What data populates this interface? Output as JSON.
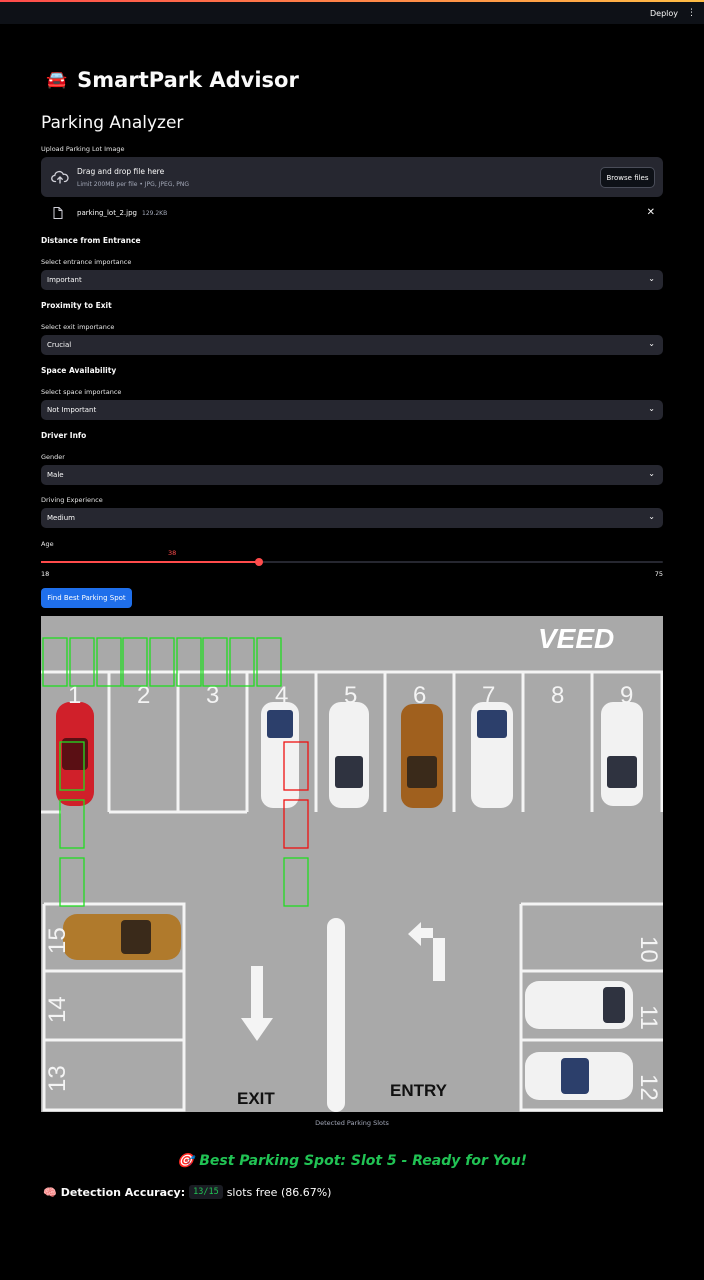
{
  "header": {
    "deploy_label": "Deploy",
    "menu_icon": "kebab-menu-icon"
  },
  "app": {
    "title_emoji": "🚘",
    "title": "SmartPark Advisor",
    "subtitle": "Parking Analyzer"
  },
  "uploader": {
    "label": "Upload Parking Lot Image",
    "drag_text": "Drag and drop file here",
    "limit_text": "Limit 200MB per file • JPG, JPEG, PNG",
    "browse_label": "Browse files",
    "file_name": "parking_lot_2.jpg",
    "file_size": "129.2KB"
  },
  "sections": {
    "entrance": {
      "heading": "Distance from Entrance",
      "label": "Select entrance importance",
      "value": "Important"
    },
    "exit": {
      "heading": "Proximity to Exit",
      "label": "Select exit importance",
      "value": "Crucial"
    },
    "space": {
      "heading": "Space Availability",
      "label": "Select space importance",
      "value": "Not Important"
    },
    "driver": {
      "heading": "Driver Info",
      "gender_label": "Gender",
      "gender_value": "Male",
      "experience_label": "Driving Experience",
      "experience_value": "Medium"
    }
  },
  "age": {
    "label": "Age",
    "value": 38,
    "min": 18,
    "max": 75
  },
  "find_button": "Find Best Parking Spot",
  "lot_image": {
    "watermark": "VEED",
    "slot_numbers_top": [
      "1",
      "2",
      "3",
      "4",
      "5",
      "6",
      "7",
      "8",
      "9"
    ],
    "slot_numbers_right": [
      "10",
      "11",
      "12"
    ],
    "slot_numbers_left": [
      "15",
      "14",
      "13"
    ],
    "exit_label": "EXIT",
    "entry_label": "ENTRY",
    "colors": {
      "free_box": "#22dd22",
      "occupied_box": "#ee1111",
      "asphalt": "#a9a9a9"
    }
  },
  "caption": "Detected Parking Slots",
  "result": {
    "best_emoji": "🎯",
    "best_text": "Best Parking Spot: Slot 5 - Ready for You!",
    "accuracy_emoji": "🧠",
    "accuracy_label": "Detection Accuracy:",
    "accuracy_code": "13/15",
    "accuracy_rest": "slots free (86.67%)"
  }
}
